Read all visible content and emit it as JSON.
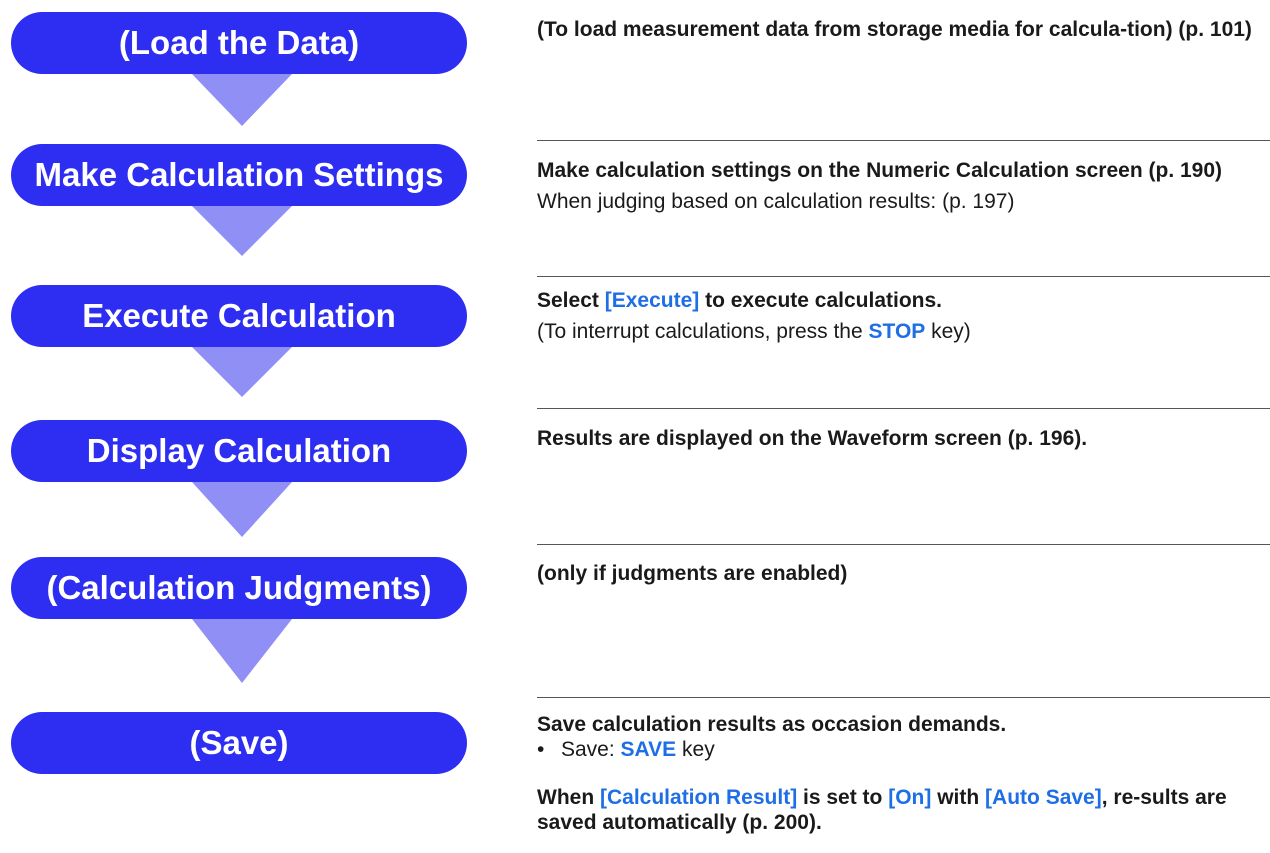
{
  "colors": {
    "step_fill": "#2e2ef2",
    "arrow_fill": "#8f8ff6",
    "highlight": "#1e6fe6"
  },
  "steps": [
    {
      "label": "(Load the Data)"
    },
    {
      "label": "Make Calculation Settings"
    },
    {
      "label": "Execute Calculation"
    },
    {
      "label": "Display Calculation"
    },
    {
      "label": "(Calculation Judgments)"
    },
    {
      "label": "(Save)"
    }
  ],
  "descriptions": {
    "load": {
      "text": "(To load measurement data from storage media for calcula-tion) (p. 101)"
    },
    "settings": {
      "line1": "Make calculation settings on the Numeric Calculation screen (p. 190)",
      "line2": "When judging based on calculation results: (p. 197)"
    },
    "execute": {
      "line1_a": "Select ",
      "line1_key": "[Execute]",
      "line1_b": " to execute calculations.",
      "line2_a": "(To interrupt calculations, press the ",
      "line2_key": "STOP",
      "line2_b": " key)"
    },
    "display": {
      "text": "Results are displayed on the Waveform screen (p. 196)."
    },
    "judgments": {
      "text": "(only if judgments are enabled)"
    },
    "save": {
      "line1": "Save calculation results as occasion demands.",
      "bullet": "•",
      "bullet_a": "Save: ",
      "bullet_key": "SAVE",
      "bullet_b": " key",
      "note_a": "When ",
      "note_key1": "[Calculation Result]",
      "note_b": " is set to ",
      "note_key2": "[On]",
      "note_c": " with ",
      "note_key3": "[Auto Save]",
      "note_d": ", re-sults are saved automatically (p. 200)."
    }
  }
}
